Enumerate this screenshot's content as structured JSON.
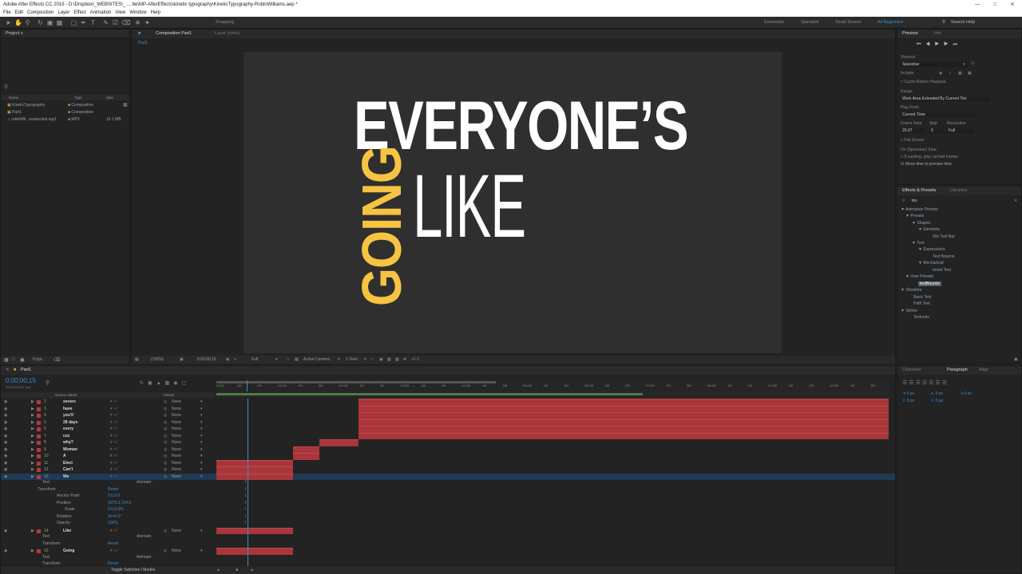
{
  "window": {
    "title": "Adobe After Effects CC 2015 - D:\\Dropbox\\_WEBSITES\\_ ... be\\MP-AfterEffects\\kinetic typography\\KineticTypography-RobinWilliams.aep *"
  },
  "menu": [
    "File",
    "Edit",
    "Composition",
    "Layer",
    "Effect",
    "Animation",
    "View",
    "Window",
    "Help"
  ],
  "toolbar": {
    "snapping": "Snapping",
    "workspaces": [
      "Essentials",
      "Standard",
      "Small Screen",
      "All Beginners"
    ],
    "search": "Search Help"
  },
  "project": {
    "title": "Project",
    "columns": [
      "Name",
      "Type",
      "Size"
    ],
    "items": [
      {
        "name": "KineticTypography",
        "type": "Composition",
        "size": ""
      },
      {
        "name": "Part1",
        "type": "Composition",
        "size": ""
      },
      {
        "name": "robinWil...residential.mp3",
        "type": "MP3",
        "size": "16.1 MB"
      }
    ],
    "bpc": "8 bpc"
  },
  "comp": {
    "tab": "Composition Part1",
    "layer_tab": "Layer (none)",
    "breadcrumb": "Part1",
    "zoom": "(105%)",
    "time": "0;00;00;15",
    "res": "Full",
    "camera": "Active Camera",
    "views": "1 View",
    "exposure": "+0.0",
    "words": {
      "everyones": "EVERYONE’S",
      "going": "GOING",
      "like": "LIKE"
    },
    "colors": {
      "white": "#ffffff",
      "yellow": "#f6c342",
      "bg": "#2d2d2d"
    }
  },
  "preview": {
    "tabs": [
      "Preview",
      "Info"
    ],
    "shortcut_label": "Shortcut",
    "shortcut": "Spacebar",
    "include_label": "Include:",
    "cache": "Cache Before Playback",
    "range_label": "Range",
    "range": "Work Area Extended By Current Tim",
    "play_from_label": "Play From",
    "play_from": "Current Time",
    "frame_rate_label": "Frame Rate",
    "skip_label": "Skip",
    "resolution_label": "Resolution",
    "frame_rate": "29.97",
    "skip": "0",
    "resolution": "Full",
    "full_screen": "Full Screen",
    "stop_label": "On (Spacebar) Stop:",
    "if_caching": "If caching, play cached frames",
    "move_time": "Move time to preview time"
  },
  "effects": {
    "tabs": [
      "Effects & Presets",
      "Libraries"
    ],
    "search": "tex",
    "tree": [
      "▼ Animation Presets",
      "▼ Presets",
      "▼ Shapes",
      "▼ Elements",
      "60s Text Bar",
      "▼ Text",
      "▼ Expressions",
      "Text Bounce",
      "▼ Mechanical",
      "Insert Text",
      "▼ User Presets",
      "textBounce",
      "▼ Obsolete",
      "Basic Text",
      "Path Text",
      "▼ Stylize",
      "Texturize"
    ]
  },
  "paragraph": {
    "tabs": [
      "Character",
      "Paragraph",
      "Align"
    ],
    "values": [
      "0 px",
      "0 px",
      "0 px",
      "0 px",
      "0 px"
    ]
  },
  "timeline": {
    "tab": "Part1",
    "timecode": "0;00;00;15",
    "fps": "00015 (29.97 fps)",
    "source_label": "Source Name",
    "parent_label": "Parent",
    "toggle": "Toggle Switches / Modes",
    "ruler": [
      "0:00f",
      "10f",
      "20f",
      "01:00f",
      "10f",
      "20f",
      "02:00f",
      "10f",
      "20f",
      "03:00f",
      "10f",
      "20f",
      "04:00f",
      "10f",
      "20f",
      "05:00f",
      "10f",
      "20f",
      "06:00f",
      "10f",
      "20f",
      "07:00f",
      "10f",
      "20f",
      "08:00f",
      "10f",
      "20f",
      "09:00f",
      "10f",
      "20f",
      "10:00f",
      "10f",
      "20f"
    ],
    "layers": [
      {
        "n": "2",
        "name": "severe",
        "parent": "None"
      },
      {
        "n": "3",
        "name": "have",
        "parent": "None"
      },
      {
        "n": "4",
        "name": "you'll",
        "parent": "None"
      },
      {
        "n": "5",
        "name": "28 days",
        "parent": "None"
      },
      {
        "n": "6",
        "name": "every",
        "parent": "None"
      },
      {
        "n": "7",
        "name": "cuz",
        "parent": "None"
      },
      {
        "n": "8",
        "name": "why?",
        "parent": "None"
      },
      {
        "n": "9",
        "name": "Woman",
        "parent": "None"
      },
      {
        "n": "10",
        "name": "A",
        "parent": "None"
      },
      {
        "n": "11",
        "name": "Elect",
        "parent": "None"
      },
      {
        "n": "12",
        "name": "Can't",
        "parent": "None"
      },
      {
        "n": "13",
        "name": "We",
        "parent": "None"
      }
    ],
    "props": {
      "text": "Text",
      "animate": "Animate:",
      "transform": "Transform",
      "reset": "Reset",
      "anchor": "Anchor Point",
      "anchor_v": "0.0,0.0",
      "position": "Position",
      "position_v": "1075.3,724.0",
      "scale": "Scale",
      "scale_v": "0.0,0.0%",
      "rotation": "Rotation",
      "rotation_v": "0x+0.0°",
      "opacity": "Opacity",
      "opacity_v": "100%"
    },
    "layers2": [
      {
        "n": "14",
        "name": "Like",
        "parent": "None"
      },
      {
        "n": "15",
        "name": "Going",
        "parent": "None"
      }
    ]
  }
}
